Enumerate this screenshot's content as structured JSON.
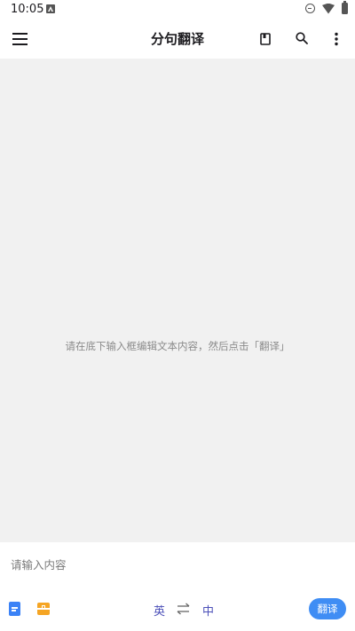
{
  "status_bar": {
    "time": "10:05"
  },
  "top_bar": {
    "title": "分句翻译",
    "icons": {
      "menu": "hamburger-menu-icon",
      "book": "book-icon",
      "search": "search-icon",
      "more": "more-vert-icon"
    }
  },
  "content": {
    "hint": "请在底下输入框编辑文本内容，然后点击「翻译」"
  },
  "input": {
    "placeholder": "请输入内容",
    "value": ""
  },
  "toolbar": {
    "source_lang": "英",
    "target_lang": "中",
    "translate_label": "翻译",
    "colors": {
      "accent": "#3f8df4",
      "lang_text": "#4b4fb8",
      "doc_icon": "#3b82f6",
      "box_icon": "#f5a524"
    }
  }
}
